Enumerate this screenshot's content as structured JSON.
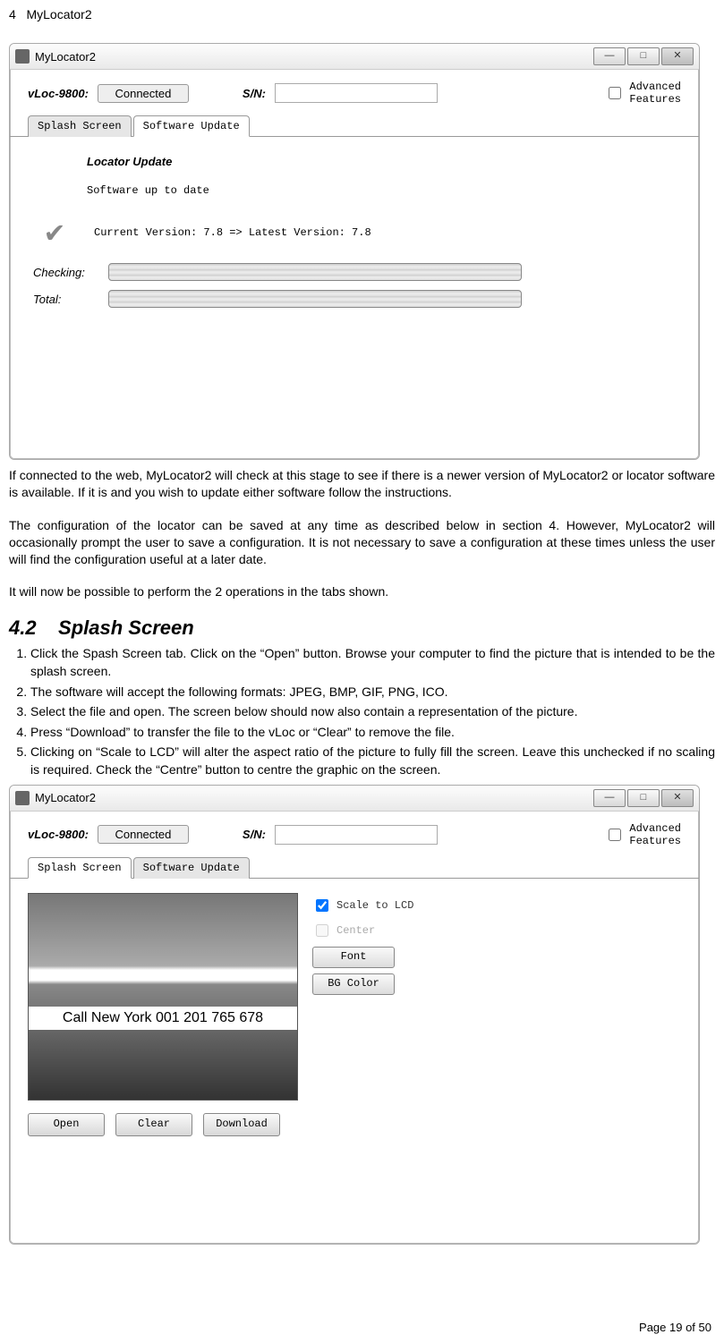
{
  "header": {
    "chapter_num": "4",
    "chapter_title": "MyLocator2"
  },
  "window1": {
    "title": "MyLocator2",
    "device_label": "vLoc-9800:",
    "connection_state": "Connected",
    "sn_label": "S/N:",
    "adv_label": "Advanced\nFeatures",
    "tabs": {
      "splash": "Splash Screen",
      "update": "Software Update"
    },
    "update_heading": "Locator Update",
    "uptodate": "Software up to date",
    "version_line": "Current Version: 7.8   =>   Latest Version: 7.8",
    "checking_label": "Checking:",
    "total_label": "Total:"
  },
  "para1": "If connected to the web, MyLocator2 will check at this stage to see if there is a newer version of MyLocator2 or locator software is available. If it is and you wish to update either software follow the instructions.",
  "para2": "The configuration of the locator can be saved at any time as described below in section 4. However, MyLocator2 will occasionally prompt the user to save a configuration. It is not necessary to save a configuration at these times unless the user will find the configuration useful at a later date.",
  "para3": "It will now be possible to perform the 2 operations in the tabs shown.",
  "section": {
    "num": "4.2",
    "title": "Splash Screen"
  },
  "steps": [
    "Click the Spash Screen tab. Click on the “Open” button. Browse your computer to find the picture that is intended to be the splash screen.",
    "The software will accept the following formats: JPEG, BMP, GIF, PNG, ICO.",
    "Select the file and open. The screen below should now also contain a representation of the picture.",
    "Press “Download” to transfer the file to the vLoc or “Clear” to remove the file.",
    "Clicking on “Scale to LCD” will alter the aspect ratio of the picture to fully fill the screen. Leave this unchecked if no scaling is required. Check the “Centre” button to centre the graphic on the screen."
  ],
  "window2": {
    "title": "MyLocator2",
    "device_label": "vLoc-9800:",
    "connection_state": "Connected",
    "sn_label": "S/N:",
    "adv_label": "Advanced\nFeatures",
    "tabs": {
      "splash": "Splash Screen",
      "update": "Software Update"
    },
    "banner_text": "Call New York 001 201 765 678",
    "scale_label": "Scale to LCD",
    "center_label": "Center",
    "font_btn": "Font",
    "bg_btn": "BG Color",
    "open_btn": "Open",
    "clear_btn": "Clear",
    "download_btn": "Download"
  },
  "footer": "Page 19 of 50"
}
